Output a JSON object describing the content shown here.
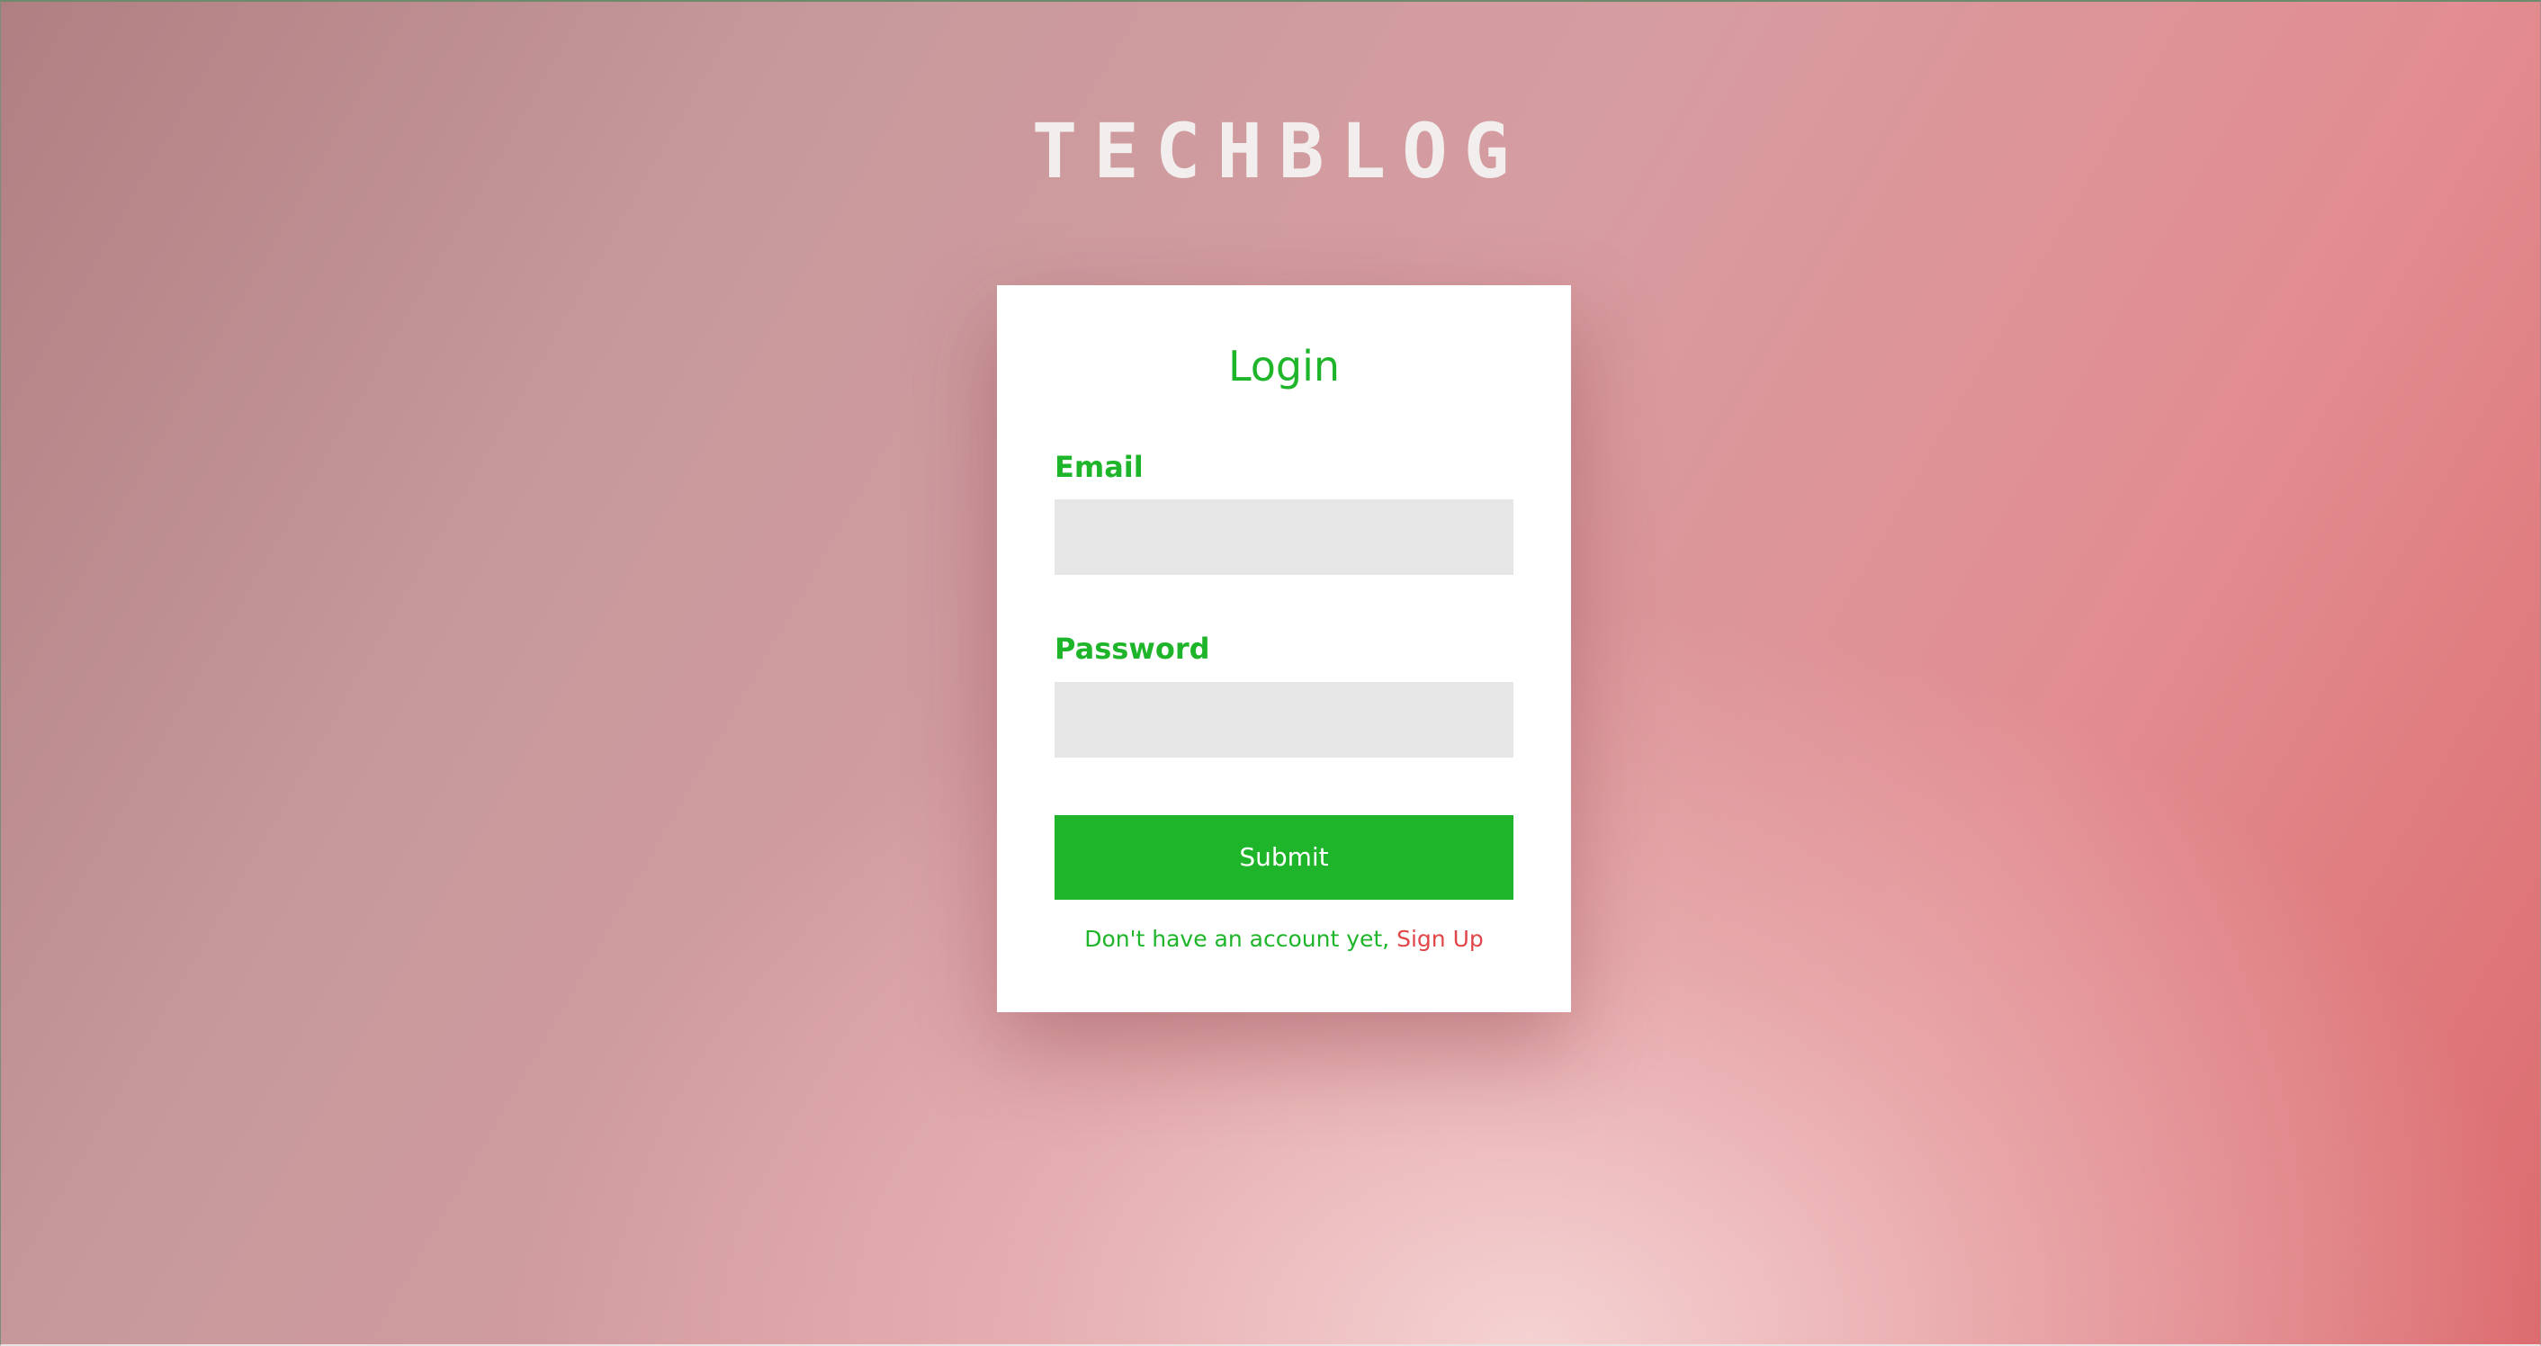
{
  "brand": {
    "logo_text": "TECHBLOG"
  },
  "login_form": {
    "title": "Login",
    "email_label": "Email",
    "email_value": "",
    "password_label": "Password",
    "password_value": "",
    "submit_label": "Submit",
    "signup_prompt": "Don't have an account yet,",
    "signup_link_label": "Sign Up"
  },
  "colors": {
    "accent_green": "#1fb52a",
    "link_red": "#e0464a",
    "input_bg": "#e6e6e6",
    "card_bg": "#ffffff"
  }
}
